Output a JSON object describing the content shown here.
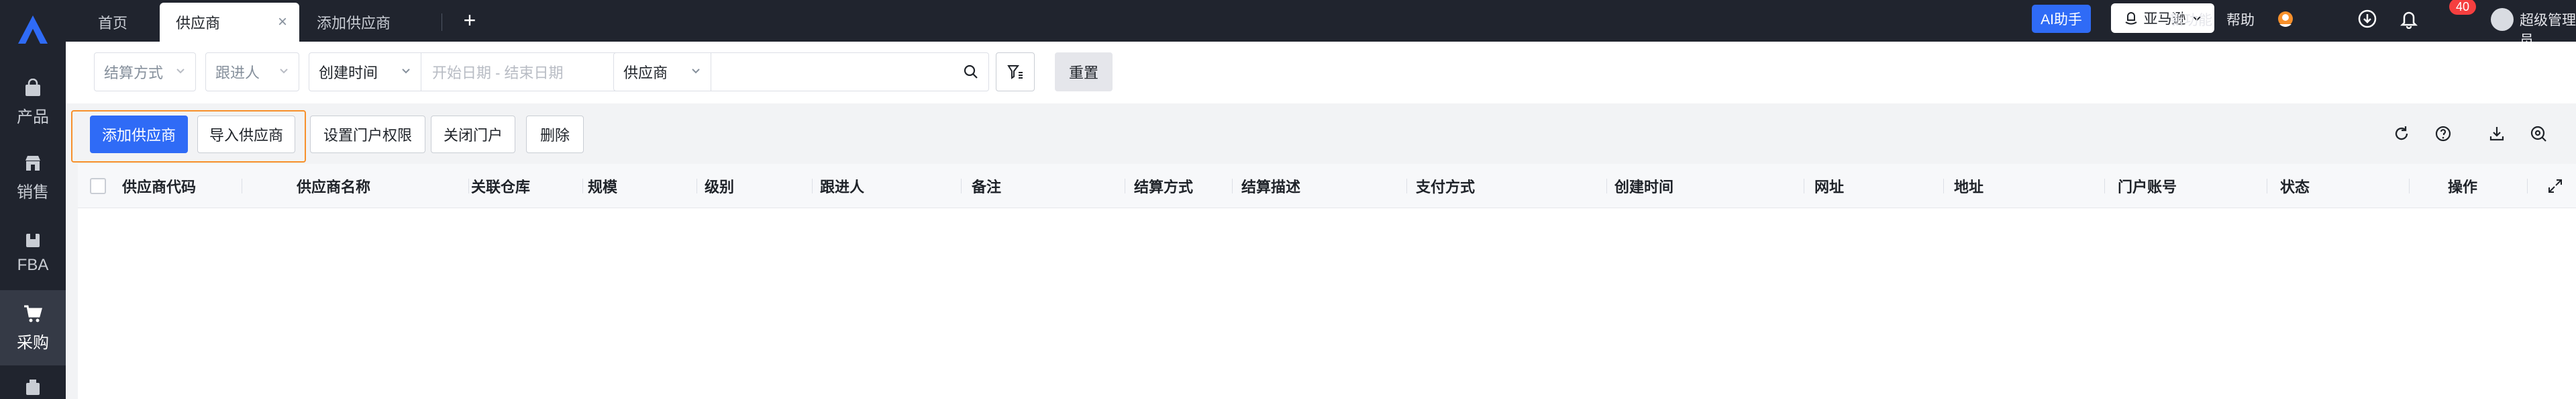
{
  "sidebar": {
    "items": [
      {
        "label": "产品",
        "icon": "bag-icon"
      },
      {
        "label": "销售",
        "icon": "shop-icon"
      },
      {
        "label": "FBA",
        "icon": "box-icon"
      },
      {
        "label": "采购",
        "icon": "cart-icon",
        "active": true
      }
    ]
  },
  "tabs": [
    {
      "label": "首页"
    },
    {
      "label": "供应商",
      "active": true
    },
    {
      "label": "添加供应商"
    }
  ],
  "topbar": {
    "ai_label": "AI助手",
    "store_label": "亚马逊",
    "new_feature": "新功能",
    "help": "帮助",
    "notification_count": "40",
    "user_name": "超级管理员"
  },
  "filters": {
    "settlement": "结算方式",
    "follower": "跟进人",
    "date_type": "创建时间",
    "date_range": "开始日期 - 结束日期",
    "search_type": "供应商",
    "search_value": "",
    "reset": "重置"
  },
  "actions": {
    "add_supplier": "添加供应商",
    "import_supplier": "导入供应商",
    "portal_permission": "设置门户权限",
    "close_portal": "关闭门户",
    "delete": "删除"
  },
  "table": {
    "columns": [
      "供应商代码",
      "供应商名称",
      "关联仓库",
      "规模",
      "级别",
      "跟进人",
      "备注",
      "结算方式",
      "结算描述",
      "支付方式",
      "创建时间",
      "网址",
      "地址",
      "门户账号",
      "状态",
      "操作"
    ],
    "rows": []
  },
  "colors": {
    "sidebar_bg": "#20242e",
    "primary": "#2f6bf6",
    "highlight": "#f7902b",
    "badge": "#f53f3f"
  }
}
